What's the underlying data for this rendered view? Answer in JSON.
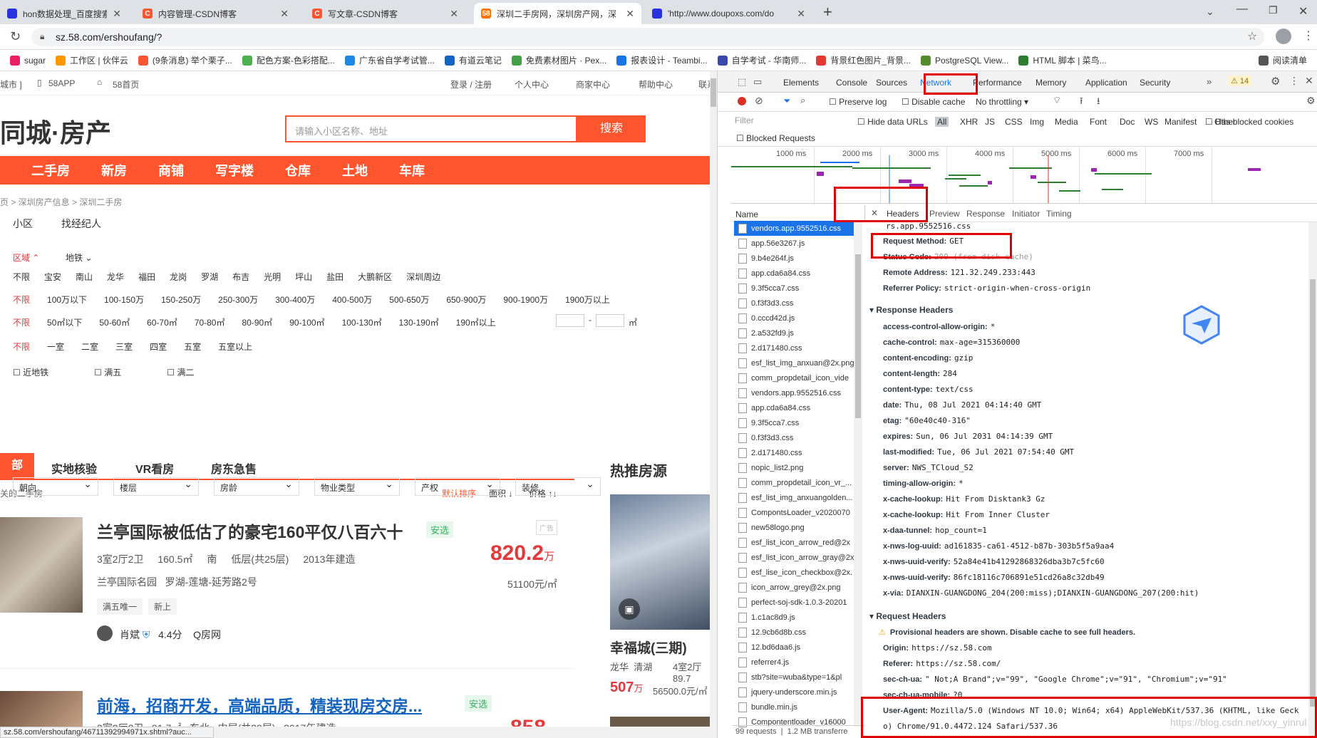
{
  "tabs": [
    {
      "title": "hon数据处理_百度搜索",
      "fav": "#2932e1"
    },
    {
      "title": "内容管理-CSDN博客",
      "fav": "#fc5531"
    },
    {
      "title": "写文章-CSDN博客",
      "fav": "#fc5531"
    },
    {
      "title": "深圳二手房网，深圳房产网，深",
      "fav": "#ff7300"
    },
    {
      "title": "'http://www.doupoxs.com/do",
      "fav": "#2932e1"
    }
  ],
  "url": "sz.58.com/ershoufang/?",
  "bookmarks": [
    "sugar",
    "工作区 | 伙伴云",
    "(9条消息) 举个栗子...",
    "配色方案-色彩搭配...",
    "广东省自学考试管...",
    "有道云笔记",
    "免费素材图片 · Pex...",
    "报表设计 - Teambi...",
    "自学考试 - 华南师...",
    "背景红色图片_背景...",
    "PostgreSQL View...",
    "HTML 脚本 | 菜鸟...",
    "阅读清单"
  ],
  "site": {
    "topbar": [
      "城市 ]",
      "58APP",
      "58首页",
      "登录 / 注册",
      "个人中心",
      "商家中心",
      "帮助中心",
      "联系"
    ],
    "logo": "同城·房产",
    "search_placeholder": "请输入小区名称、地址",
    "search_btn": "搜索",
    "nav": [
      "二手房",
      "新房",
      "商铺",
      "写字楼",
      "仓库",
      "土地",
      "车库"
    ],
    "breadcrumb": "页 > 深圳房产信息 > 深圳二手房",
    "subtabs": [
      "小区",
      "找经纪人"
    ],
    "region_label": "区域",
    "subway_label": "地铁",
    "regions": [
      "不限",
      "宝安",
      "南山",
      "龙华",
      "福田",
      "龙岗",
      "罗湖",
      "布吉",
      "光明",
      "坪山",
      "盐田",
      "大鹏新区",
      "深圳周边"
    ],
    "prices": [
      "不限",
      "100万以下",
      "100-150万",
      "150-250万",
      "250-300万",
      "300-400万",
      "400-500万",
      "500-650万",
      "650-900万",
      "900-1900万",
      "1900万以上"
    ],
    "areas": [
      "不限",
      "50㎡以下",
      "50-60㎡",
      "60-70㎡",
      "70-80㎡",
      "80-90㎡",
      "90-100㎡",
      "100-130㎡",
      "130-190㎡",
      "190㎡以上"
    ],
    "area_unit": "㎡",
    "rooms": [
      "不限",
      "一室",
      "二室",
      "三室",
      "四室",
      "五室",
      "五室以上"
    ],
    "checks": [
      "近地铁",
      "满五",
      "满二"
    ],
    "selects": [
      "朝向",
      "楼层",
      "房龄",
      "物业类型",
      "产权",
      "装修"
    ],
    "listtabs": [
      "部",
      "实地核验",
      "VR看房",
      "房东急售"
    ],
    "hot_title": "热推房源",
    "count_text": "关的二手房",
    "sorts": [
      "默认排序",
      "面积 ↓",
      "价格 ↑↓"
    ],
    "listing1": {
      "title": "兰亭国际被低估了的豪宅160平仅八百六十",
      "badge": "安选",
      "ad": "广告",
      "info": [
        "3室2厅2卫",
        "160.5㎡",
        "南",
        "低层(共25层)",
        "2013年建造"
      ],
      "community": "兰亭国际名园",
      "location": "罗湖-莲塘-延芳路2号",
      "tags": [
        "满五唯一",
        "新上"
      ],
      "agent": "肖斌",
      "score": "4.4分",
      "company": "Q房网",
      "price": "820.2",
      "unit": "万",
      "unitprice": "51100元/㎡"
    },
    "listing2": {
      "title": "前海，招商开发，高端品质，精装现房交房...",
      "badge": "安选",
      "info": "3室2厅2卫   91.7㎡   东北   中层(共29层)   2017年建造",
      "price": "858"
    },
    "hot": {
      "name": "幸福城(三期)",
      "loc": "龙华  清湖",
      "rooms": "4室2厅 89.7",
      "price": "507",
      "unit": "万",
      "unitprice": "56500.0元/㎡"
    },
    "status_url": "sz.58.com/ershoufang/46711392994971x.shtml?auc..."
  },
  "devtools": {
    "tabs": [
      "Elements",
      "Console",
      "Sources",
      "Network",
      "Performance",
      "Memory",
      "Application",
      "Security"
    ],
    "warn": "14",
    "preserve": "Preserve log",
    "disable_cache": "Disable cache",
    "throttle": "No throttling",
    "filter": "Filter",
    "hide_data": "Hide data URLs",
    "types": [
      "All",
      "XHR",
      "JS",
      "CSS",
      "Img",
      "Media",
      "Font",
      "Doc",
      "WS",
      "Manifest",
      "Other"
    ],
    "blocked_cookies": "Has blocked cookies",
    "blocked_req": "Blocked Requests",
    "timeline": [
      "1000 ms",
      "2000 ms",
      "3000 ms",
      "4000 ms",
      "5000 ms",
      "6000 ms",
      "7000 ms"
    ],
    "name_col": "Name",
    "detail_tabs": [
      "Headers",
      "Preview",
      "Response",
      "Initiator",
      "Timing"
    ],
    "requests": [
      "vendors.app.9552516.css",
      "app.56e3267.js",
      "9.b4e264f.js",
      "app.cda6a84.css",
      "9.3f5cca7.css",
      "0.f3f3d3.css",
      "0.cccd42d.js",
      "2.a532fd9.js",
      "2.d171480.css",
      "esf_list_img_anxuan@2x.png",
      "comm_propdetail_icon_vide",
      "vendors.app.9552516.css",
      "app.cda6a84.css",
      "9.3f5cca7.css",
      "0.f3f3d3.css",
      "2.d171480.css",
      "nopic_list2.png",
      "comm_propdetail_icon_vr_...",
      "esf_list_img_anxuangolden...",
      "CompontsLoader_v2020070",
      "new58logo.png",
      "esf_list_icon_arrow_red@2x",
      "esf_list_icon_arrow_gray@2x",
      "esf_lise_icon_checkbox@2x.",
      "icon_arrow_grey@2x.png",
      "perfect-soj-sdk-1.0.3-20201",
      "1.c1ac8d9.js",
      "12.9cb6d8b.css",
      "12.bd6daa6.js",
      "referrer4.js",
      "stb?site=wuba&type=1&pl",
      "jquery-underscore.min.js",
      "bundle.min.js",
      "Compontentloader_v16000"
    ],
    "footer": [
      "99 requests",
      "1.2 MB transferre"
    ],
    "general": [
      {
        "k": "",
        "v": "rs.app.9552516.css"
      },
      {
        "k": "Request Method:",
        "v": "GET"
      },
      {
        "k": "Status Code:",
        "v": "200   (from disk cache)"
      },
      {
        "k": "Remote Address:",
        "v": "121.32.249.233:443"
      },
      {
        "k": "Referrer Policy:",
        "v": "strict-origin-when-cross-origin"
      }
    ],
    "resp_title": "Response Headers",
    "resp": [
      {
        "k": "access-control-allow-origin:",
        "v": "*"
      },
      {
        "k": "cache-control:",
        "v": "max-age=315360000"
      },
      {
        "k": "content-encoding:",
        "v": "gzip"
      },
      {
        "k": "content-length:",
        "v": "284"
      },
      {
        "k": "content-type:",
        "v": "text/css"
      },
      {
        "k": "date:",
        "v": "Thu, 08 Jul 2021 04:14:40 GMT"
      },
      {
        "k": "etag:",
        "v": "\"60e40c40-316\""
      },
      {
        "k": "expires:",
        "v": "Sun, 06 Jul 2031 04:14:39 GMT"
      },
      {
        "k": "last-modified:",
        "v": "Tue, 06 Jul 2021 07:54:40 GMT"
      },
      {
        "k": "server:",
        "v": "NWS_TCloud_S2"
      },
      {
        "k": "timing-allow-origin:",
        "v": "*"
      },
      {
        "k": "x-cache-lookup:",
        "v": "Hit From Disktank3 Gz"
      },
      {
        "k": "x-cache-lookup:",
        "v": "Hit From Inner Cluster"
      },
      {
        "k": "x-daa-tunnel:",
        "v": "hop_count=1"
      },
      {
        "k": "x-nws-log-uuid:",
        "v": "ad161835-ca61-4512-b87b-303b5f5a9aa4"
      },
      {
        "k": "x-nws-uuid-verify:",
        "v": "52a84e41b41292868326dba3b7c5fc60"
      },
      {
        "k": "x-nws-uuid-verify:",
        "v": "86fc18116c706891e51cd26a8c32db49"
      },
      {
        "k": "x-via:",
        "v": "DIANXIN-GUANGDONG_204(200:miss);DIANXIN-GUANGDONG_207(200:hit)"
      }
    ],
    "req_title": "Request Headers",
    "provisional": "Provisional headers are shown. Disable cache to see full headers.",
    "reqh": [
      {
        "k": "Origin:",
        "v": "https://sz.58.com"
      },
      {
        "k": "Referer:",
        "v": "https://sz.58.com/"
      },
      {
        "k": "sec-ch-ua:",
        "v": "\" Not;A Brand\";v=\"99\", \"Google Chrome\";v=\"91\", \"Chromium\";v=\"91\""
      },
      {
        "k": "sec-ch-ua-mobile:",
        "v": "?0"
      }
    ],
    "ua_key": "User-Agent:",
    "ua_line1": "Mozilla/5.0 (Windows NT 10.0; Win64; x64) AppleWebKit/537.36 (KHTML, like Geck",
    "ua_line2": "o) Chrome/91.0.4472.124 Safari/537.36",
    "watermark": "https://blog.csdn.net/xxy_yinrul"
  }
}
